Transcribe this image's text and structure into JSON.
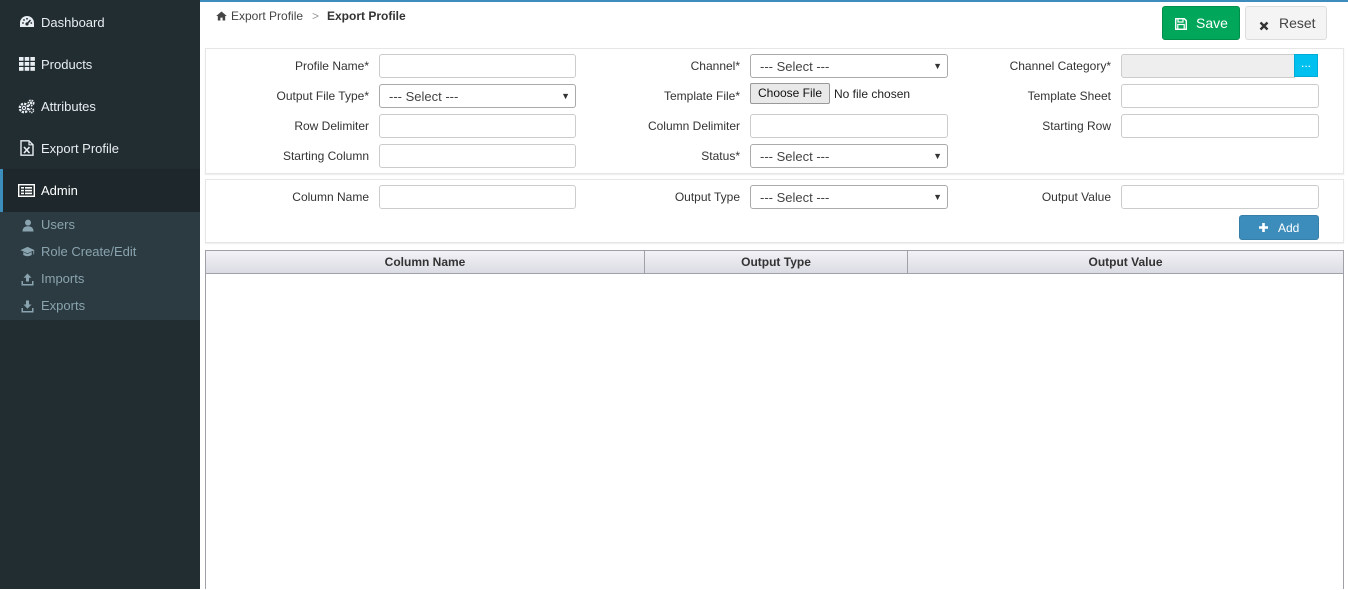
{
  "sidebar": {
    "items": [
      {
        "label": "Dashboard",
        "icon": "dashboard-icon"
      },
      {
        "label": "Products",
        "icon": "grid-icon"
      },
      {
        "label": "Attributes",
        "icon": "gears-icon"
      },
      {
        "label": "Export Profile",
        "icon": "excel-file-icon"
      },
      {
        "label": "Admin",
        "icon": "admin-icon"
      }
    ],
    "submenu": [
      {
        "label": "Users",
        "icon": "user-icon"
      },
      {
        "label": "Role Create/Edit",
        "icon": "graduation-cap-icon"
      },
      {
        "label": "Imports",
        "icon": "upload-icon"
      },
      {
        "label": "Exports",
        "icon": "download-icon"
      }
    ]
  },
  "breadcrumb": {
    "parent": "Export Profile",
    "separator": ">",
    "current": "Export Profile"
  },
  "toolbar": {
    "save_label": "Save",
    "reset_label": "Reset"
  },
  "form": {
    "profile_name": {
      "label": "Profile Name*",
      "value": ""
    },
    "channel": {
      "label": "Channel*",
      "value": "--- Select ---"
    },
    "channel_category": {
      "label": "Channel Category*",
      "value": "",
      "button": "..."
    },
    "output_file_type": {
      "label": "Output File Type*",
      "value": "--- Select ---"
    },
    "template_file": {
      "label": "Template File*",
      "button": "Choose File",
      "status": "No file chosen"
    },
    "template_sheet": {
      "label": "Template Sheet",
      "value": ""
    },
    "row_delimiter": {
      "label": "Row Delimiter",
      "value": ""
    },
    "column_delimiter": {
      "label": "Column Delimiter",
      "value": ""
    },
    "starting_row": {
      "label": "Starting Row",
      "value": ""
    },
    "starting_column": {
      "label": "Starting Column",
      "value": ""
    },
    "status": {
      "label": "Status*",
      "value": "--- Select ---"
    }
  },
  "column_form": {
    "column_name": {
      "label": "Column Name",
      "value": ""
    },
    "output_type": {
      "label": "Output Type",
      "value": "--- Select ---"
    },
    "output_value": {
      "label": "Output Value",
      "value": ""
    },
    "add_label": "Add"
  },
  "table": {
    "columns": [
      "Column Name",
      "Output Type",
      "Output Value"
    ],
    "rows": []
  },
  "colors": {
    "sidebar_bg": "#222d32",
    "accent": "#3c8dbc",
    "save_green": "#00a65a",
    "info_cyan": "#00c0ef"
  }
}
